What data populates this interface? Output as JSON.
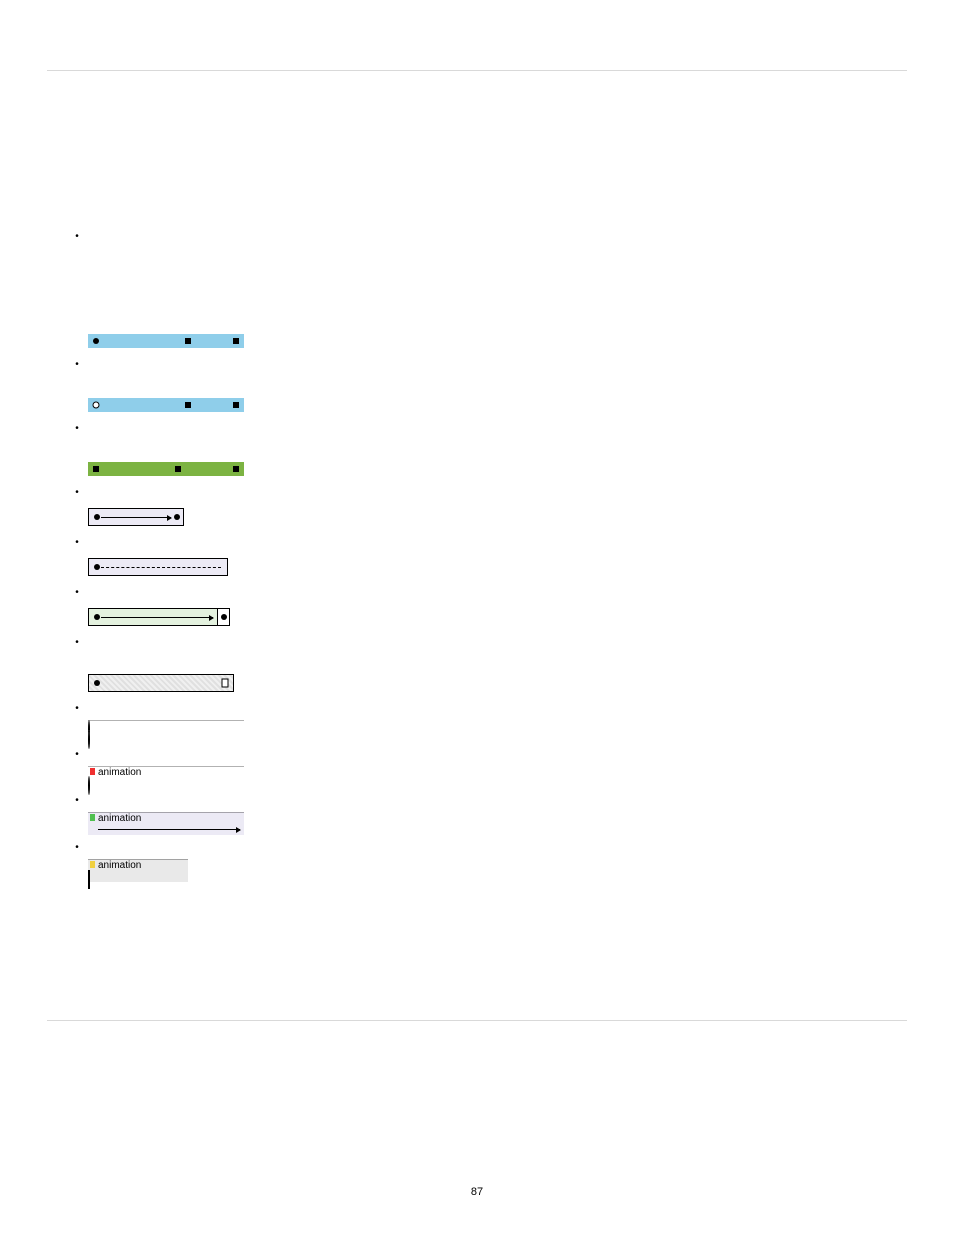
{
  "page_number": "87",
  "labels": {
    "animation": "animation"
  },
  "items": [
    {
      "text": ""
    },
    {
      "text": ""
    },
    {
      "text": ""
    },
    {
      "text": ""
    },
    {
      "text": ""
    },
    {
      "text": ""
    },
    {
      "text": ""
    },
    {
      "text": ""
    },
    {
      "text": ""
    },
    {
      "text": ""
    },
    {
      "text": ""
    }
  ]
}
